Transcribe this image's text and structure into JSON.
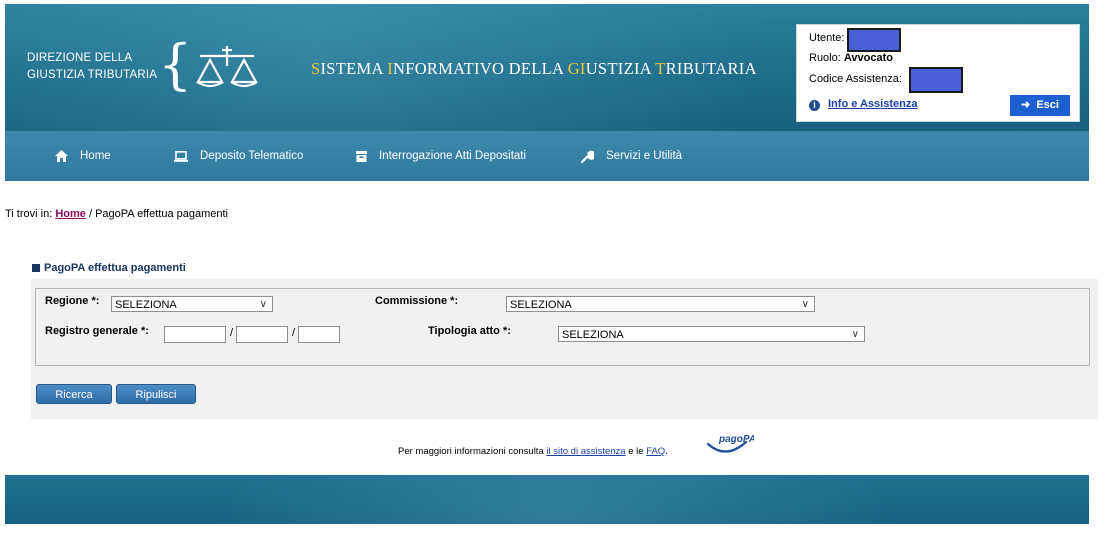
{
  "header": {
    "org_line1": "DIREZIONE DELLA",
    "org_line2": "GIUSTIZIA TRIBUTARIA",
    "system_title": {
      "s1_hl": "S",
      "s1": "ISTEMA ",
      "s2_hl": "I",
      "s2": "NFORMATIVO DELLA ",
      "s3_hl": "GI",
      "s3": "USTIZIA ",
      "s4_hl": "T",
      "s4": "RIBUTARIA"
    },
    "colors": {
      "highlight": "#f4c430",
      "band": "#1e6d8b"
    }
  },
  "userbox": {
    "utente_label": "Utente:",
    "ruolo_label": "Ruolo:",
    "ruolo_value": "Avvocato",
    "codice_label": "Codice Assistenza:",
    "info_icon": "info-icon",
    "info_link": "Info e Assistenza",
    "logout_icon": "sign-out-icon",
    "esci_label": "Esci"
  },
  "nav": {
    "items": [
      {
        "icon": "home-icon",
        "label": "Home"
      },
      {
        "icon": "laptop-icon",
        "label": "Deposito Telematico"
      },
      {
        "icon": "inbox-icon",
        "label": "Interrogazione Atti Depositati"
      },
      {
        "icon": "wrench-icon",
        "label": "Servizi e Utilità"
      }
    ]
  },
  "breadcrumb": {
    "prefix": "Ti trovi in:",
    "home": "Home",
    "separator": "/",
    "current": "PagoPA effettua pagamenti"
  },
  "section": {
    "title": "PagoPA effettua pagamenti"
  },
  "form": {
    "regione_label": "Regione *:",
    "regione_value": "SELEZIONA",
    "commissione_label": "Commissione *:",
    "commissione_value": "SELEZIONA",
    "registro_label": "Registro generale *:",
    "registro_sep": "/",
    "tipologia_label": "Tipologia atto *:",
    "tipologia_value": "SELEZIONA",
    "ricerca_label": "Ricerca",
    "ripulisci_label": "Ripulisci"
  },
  "footer": {
    "info_prefix": "Per maggiori informazioni consulta",
    "assist_link": "il sito di assistenza",
    "conj": "e le",
    "faq_link": "FAQ",
    "period": ".",
    "pagopa_logo_text": "pagoPA"
  }
}
